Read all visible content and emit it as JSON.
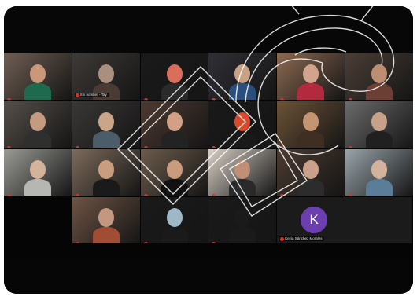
{
  "toolbar": {
    "items": [
      "▣",
      "◫",
      "▲",
      "⊞"
    ]
  },
  "tiles": [
    {
      "name": "",
      "bg": "#6f5f53",
      "face": "#c99779",
      "body": "#1d6a4f"
    },
    {
      "name": "Sin nombre - Tay",
      "bg": "#3e3a37",
      "face": "#a98f7d",
      "body": "#4a3a34"
    },
    {
      "name": "",
      "bg": "#1a1a1a",
      "face": "#d96e5d",
      "body": "#2a2a2a"
    },
    {
      "name": "",
      "bg": "#2f2f35",
      "face": "#c9a184",
      "body": "#2a4f7d"
    },
    {
      "name": "",
      "bg": "#8d6a51",
      "face": "#d2a38d",
      "body": "#b32a3f"
    },
    {
      "name": "",
      "bg": "#4b3e36",
      "face": "#bd8f72",
      "body": "#6c3f35"
    },
    {
      "name": "",
      "bg": "#554f49",
      "face": "#c49b80",
      "body": "#2f2f2f"
    },
    {
      "name": "",
      "bg": "#3a3836",
      "face": "#caa58a",
      "body": "#4b5d68"
    },
    {
      "name": "",
      "bg": "#4e3a31",
      "face": "#d1a085",
      "body": "#232323"
    },
    {
      "name": "",
      "bg": "#191919",
      "face": "#d84a2c",
      "body": "#191919"
    },
    {
      "name": "",
      "bg": "#6c5336",
      "face": "#c59573",
      "body": "#3f2e22"
    },
    {
      "name": "",
      "bg": "#6b6b6b",
      "face": "#c7a188",
      "body": "#202020"
    },
    {
      "name": "",
      "bg": "#9b9b96",
      "face": "#d4b39c",
      "body": "#b6b6b2"
    },
    {
      "name": "",
      "bg": "#7c6b5b",
      "face": "#c99e80",
      "body": "#1a1a1a"
    },
    {
      "name": "",
      "bg": "#6c5c4c",
      "face": "#c89c7c",
      "body": "#111111"
    },
    {
      "name": "",
      "bg": "#d8cfc5",
      "face": "#c18e78",
      "body": "#2a2a2a"
    },
    {
      "name": "",
      "bg": "#4b3b31",
      "face": "#caa08a",
      "body": "#2c2c2c"
    },
    {
      "name": "",
      "bg": "#9aa5ab",
      "face": "#d3b39e",
      "body": "#5c7d98"
    },
    {
      "name": "",
      "bg": "#6e5445",
      "face": "#c29880",
      "body": "#a14d36"
    },
    {
      "name": "",
      "bg": "#1a1a1a",
      "face": "#9fb7c7",
      "body": "#1a1a1a"
    },
    {
      "name": "",
      "bg": "#1a1a1a",
      "face": "#1a1a1a",
      "body": "#1a1a1a"
    }
  ],
  "avatar": {
    "initial": "K",
    "name": "Kezia Sánchez Morales",
    "color": "#6b3fb0"
  },
  "colors": {
    "background": "#050505",
    "mic_muted": "#d9342b"
  }
}
